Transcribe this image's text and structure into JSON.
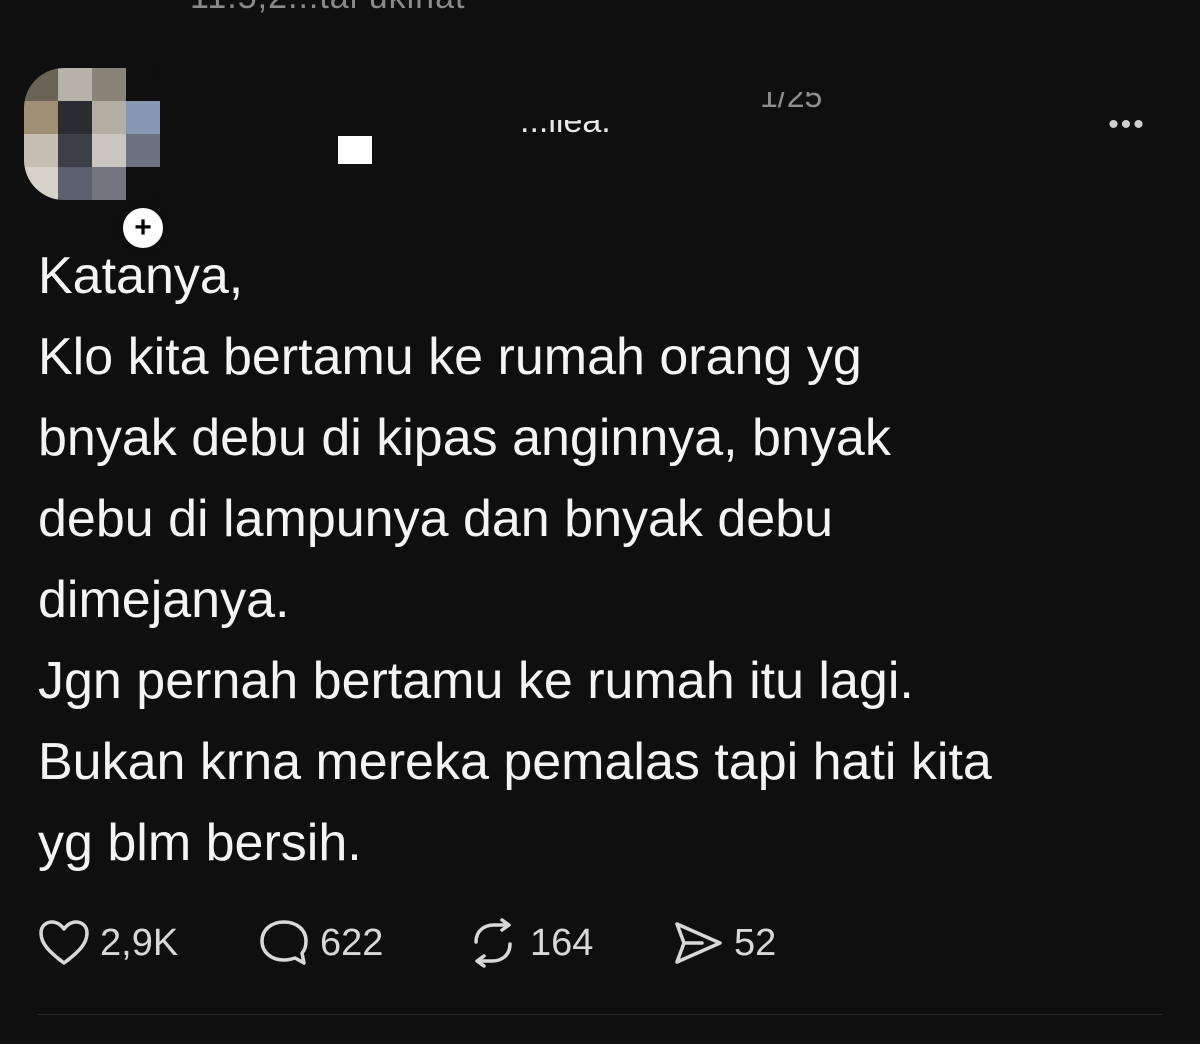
{
  "header": {
    "top_cut_text": "11.5,2..:tal ukinat",
    "username_fragment": "...ilea.",
    "timestamp_fragment": "1/25",
    "more_label": "•••",
    "follow_plus": "+"
  },
  "post": {
    "lines": [
      "Katanya,",
      "Klo kita bertamu ke rumah orang yg",
      "bnyak debu di kipas anginnya, bnyak",
      "debu di lampunya dan bnyak debu",
      "dimejanya.",
      "Jgn pernah bertamu ke rumah itu lagi.",
      "Bukan krna mereka pemalas tapi hati kita",
      "yg blm bersih."
    ]
  },
  "actions": {
    "like_count": "2,9K",
    "reply_count": "622",
    "repost_count": "164",
    "share_count": "52"
  },
  "icons": {
    "like": "heart-icon",
    "reply": "speech-bubble-icon",
    "repost": "repost-icon",
    "share": "send-icon",
    "more": "ellipsis-icon"
  },
  "colors": {
    "background": "#0f0f10",
    "text": "#f4f4f4",
    "muted": "#8e8e8e",
    "divider": "#2a2a2a"
  }
}
